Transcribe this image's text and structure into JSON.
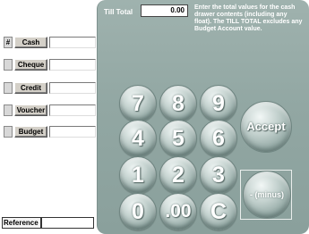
{
  "tenders": {
    "marker": "#",
    "items": [
      {
        "label": "Cash",
        "value": ""
      },
      {
        "label": "Cheque",
        "value": ""
      },
      {
        "label": "Credit",
        "value": ""
      },
      {
        "label": "Voucher",
        "value": ""
      },
      {
        "label": "Budget",
        "value": ""
      }
    ]
  },
  "reference": {
    "label": "Reference",
    "value": ""
  },
  "till": {
    "label": "Till Total",
    "value": "0.00",
    "instructions": "Enter the total values for the cash drawer contents (including any float). The TILL TOTAL excludes any Budget Account value."
  },
  "keypad": {
    "k7": "7",
    "k8": "8",
    "k9": "9",
    "k4": "4",
    "k5": "5",
    "k6": "6",
    "k1": "1",
    "k2": "2",
    "k3": "3",
    "k0": "0",
    "k00": ".00",
    "kc": "C",
    "accept": "Accept",
    "minus": "- (minus)"
  }
}
